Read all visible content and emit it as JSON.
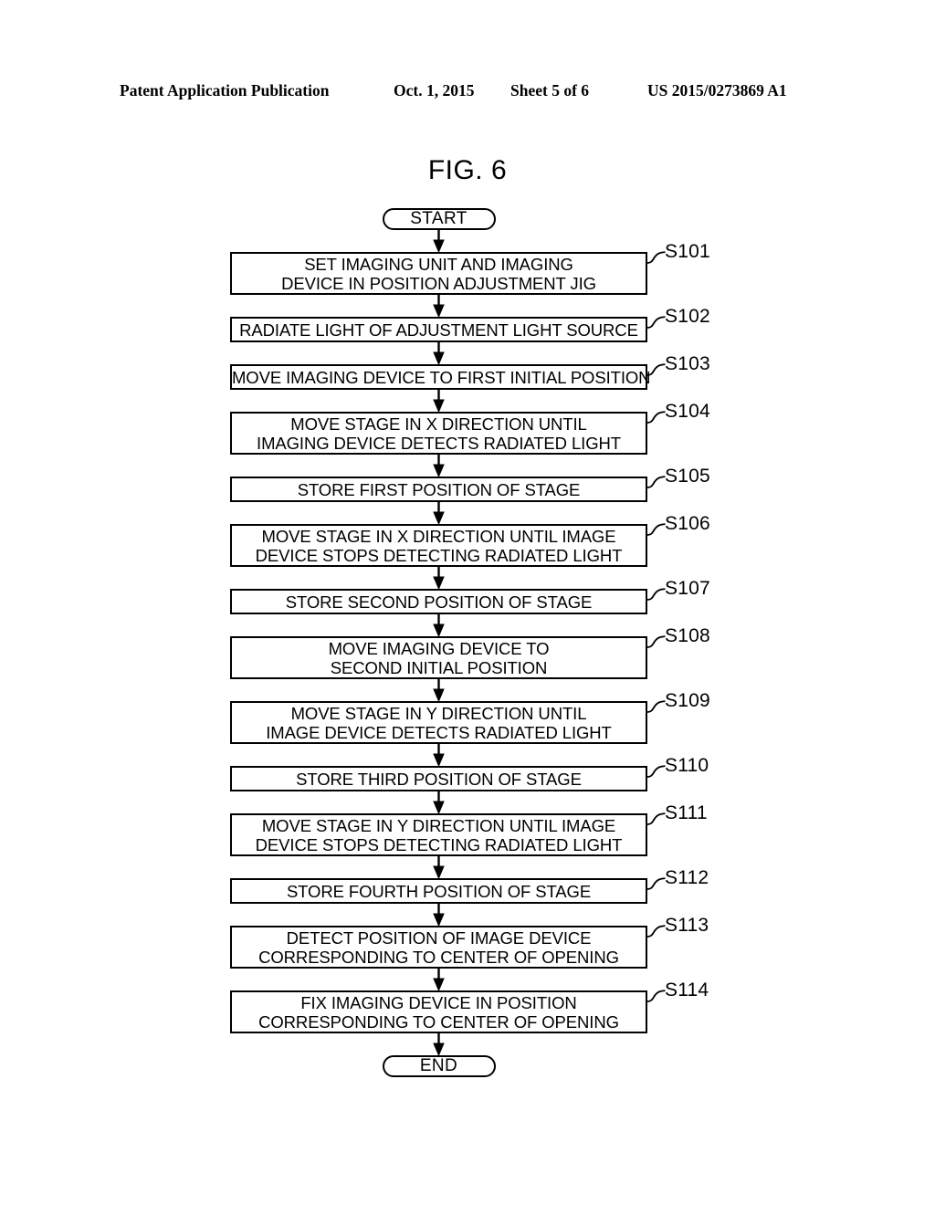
{
  "header": {
    "publication": "Patent Application Publication",
    "date": "Oct. 1, 2015",
    "sheet": "Sheet 5 of 6",
    "number": "US 2015/0273869 A1"
  },
  "figure": {
    "title": "FIG. 6",
    "start_label": "START",
    "end_label": "END"
  },
  "flowchart": {
    "steps": [
      {
        "id": "S101",
        "line1": "SET IMAGING UNIT AND IMAGING",
        "line2": "DEVICE IN POSITION ADJUSTMENT JIG"
      },
      {
        "id": "S102",
        "line1": "RADIATE LIGHT OF ADJUSTMENT LIGHT SOURCE",
        "line2": ""
      },
      {
        "id": "S103",
        "line1": "MOVE IMAGING DEVICE TO FIRST INITIAL POSITION",
        "line2": ""
      },
      {
        "id": "S104",
        "line1": "MOVE STAGE IN X DIRECTION UNTIL",
        "line2": "IMAGING DEVICE DETECTS RADIATED LIGHT"
      },
      {
        "id": "S105",
        "line1": "STORE FIRST POSITION OF STAGE",
        "line2": ""
      },
      {
        "id": "S106",
        "line1": "MOVE STAGE IN X DIRECTION UNTIL IMAGE",
        "line2": "DEVICE STOPS DETECTING RADIATED LIGHT"
      },
      {
        "id": "S107",
        "line1": "STORE SECOND POSITION OF STAGE",
        "line2": ""
      },
      {
        "id": "S108",
        "line1": "MOVE IMAGING DEVICE TO",
        "line2": "SECOND INITIAL POSITION"
      },
      {
        "id": "S109",
        "line1": "MOVE STAGE IN Y DIRECTION UNTIL",
        "line2": "IMAGE DEVICE DETECTS RADIATED LIGHT"
      },
      {
        "id": "S110",
        "line1": "STORE THIRD POSITION OF STAGE",
        "line2": ""
      },
      {
        "id": "S111",
        "line1": "MOVE STAGE IN Y DIRECTION UNTIL IMAGE",
        "line2": "DEVICE STOPS DETECTING RADIATED LIGHT"
      },
      {
        "id": "S112",
        "line1": "STORE FOURTH POSITION OF STAGE",
        "line2": ""
      },
      {
        "id": "S113",
        "line1": "DETECT POSITION OF IMAGE DEVICE",
        "line2": "CORRESPONDING TO CENTER OF OPENING"
      },
      {
        "id": "S114",
        "line1": "FIX IMAGING DEVICE IN POSITION",
        "line2": "CORRESPONDING TO CENTER OF OPENING"
      }
    ]
  },
  "colors": {
    "ink": "#000000",
    "paper": "#ffffff"
  }
}
